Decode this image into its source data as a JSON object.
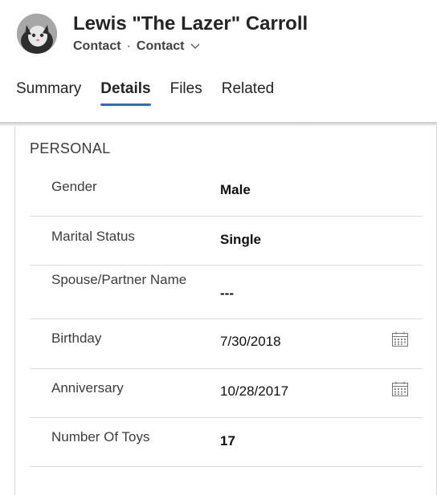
{
  "header": {
    "name": "Lewis \"The Lazer\" Carroll",
    "entity": "Contact",
    "form": "Contact",
    "separator": "·"
  },
  "tabs": [
    {
      "label": "Summary",
      "active": false
    },
    {
      "label": "Details",
      "active": true
    },
    {
      "label": "Files",
      "active": false
    },
    {
      "label": "Related",
      "active": false
    }
  ],
  "section": {
    "title": "PERSONAL",
    "fields": [
      {
        "label": "Gender",
        "value": "Male"
      },
      {
        "label": "Marital Status",
        "value": "Single"
      },
      {
        "label": "Spouse/Partner Name",
        "value": "---"
      },
      {
        "label": "Birthday",
        "value": "7/30/2018"
      },
      {
        "label": "Anniversary",
        "value": "10/28/2017"
      },
      {
        "label": "Number Of Toys",
        "value": "17"
      }
    ]
  },
  "icons": {
    "chevron": "chevron-down-icon",
    "calendar": "calendar-icon"
  },
  "colors": {
    "accent": "#2b6bd1"
  }
}
